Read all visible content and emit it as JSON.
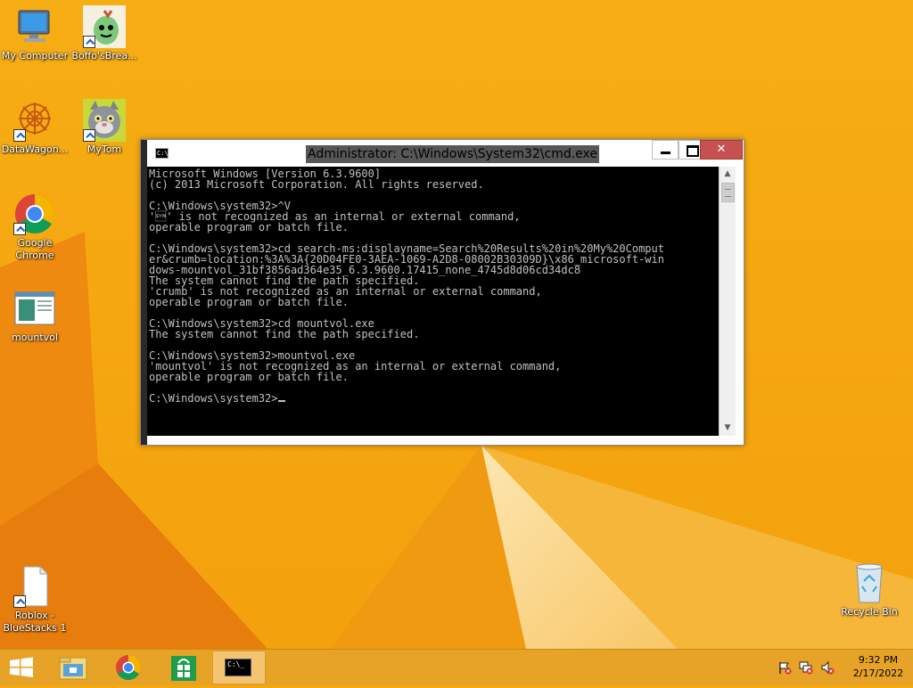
{
  "desktop": {
    "icons": [
      {
        "label": "My Computer",
        "name": "my-computer"
      },
      {
        "label": "Boffo'sBrea...",
        "name": "boffos-breakfast"
      },
      {
        "label": "DataWagon...",
        "name": "datawagon"
      },
      {
        "label": "MyTom",
        "name": "mytom"
      },
      {
        "label": "Google Chrome",
        "name": "google-chrome"
      },
      {
        "label": "mountvol",
        "name": "mountvol"
      },
      {
        "label": "Roblox - BlueStacks 1",
        "name": "roblox-bluestacks"
      },
      {
        "label": "Recycle Bin",
        "name": "recycle-bin"
      }
    ]
  },
  "cmd": {
    "title": "Administrator: C:\\Windows\\System32\\cmd.exe",
    "icon_text": "C:\\",
    "close_glyph": "✕",
    "output": "Microsoft Windows [Version 6.3.9600]\n(c) 2013 Microsoft Corporation. All rights reserved.\n\nC:\\Windows\\system32>^V\n'\u0016' is not recognized as an internal or external command,\noperable program or batch file.\n\nC:\\Windows\\system32>cd search-ms:displayname=Search%20Results%20in%20My%20Comput\ner&crumb=location:%3A%3A{20D04FE0-3AEA-1069-A2D8-08002B30309D}\\x86_microsoft-win\ndows-mountvol_31bf3856ad364e35_6.3.9600.17415_none_4745d8d06cd34dc8\nThe system cannot find the path specified.\n'crumb' is not recognized as an internal or external command,\noperable program or batch file.\n\nC:\\Windows\\system32>cd mountvol.exe\nThe system cannot find the path specified.\n\nC:\\Windows\\system32>mountvol.exe\n'mountvol' is not recognized as an internal or external command,\noperable program or batch file.\n\nC:\\Windows\\system32>",
    "scroll_up": "▲",
    "scroll_down": "▼"
  },
  "taskbar": {
    "items": [
      "start",
      "file-explorer",
      "google-chrome",
      "windows-store",
      "command-prompt"
    ],
    "cmd_icon_text": "C:\\_"
  },
  "clock": {
    "time": "9:32 PM",
    "date": "2/17/2022"
  },
  "colors": {
    "wallpaper": "#f5a80e",
    "taskbar": "#e7a327",
    "console_bg": "#000000",
    "console_fg": "#c0c0c0",
    "close_button": "#c75050"
  }
}
